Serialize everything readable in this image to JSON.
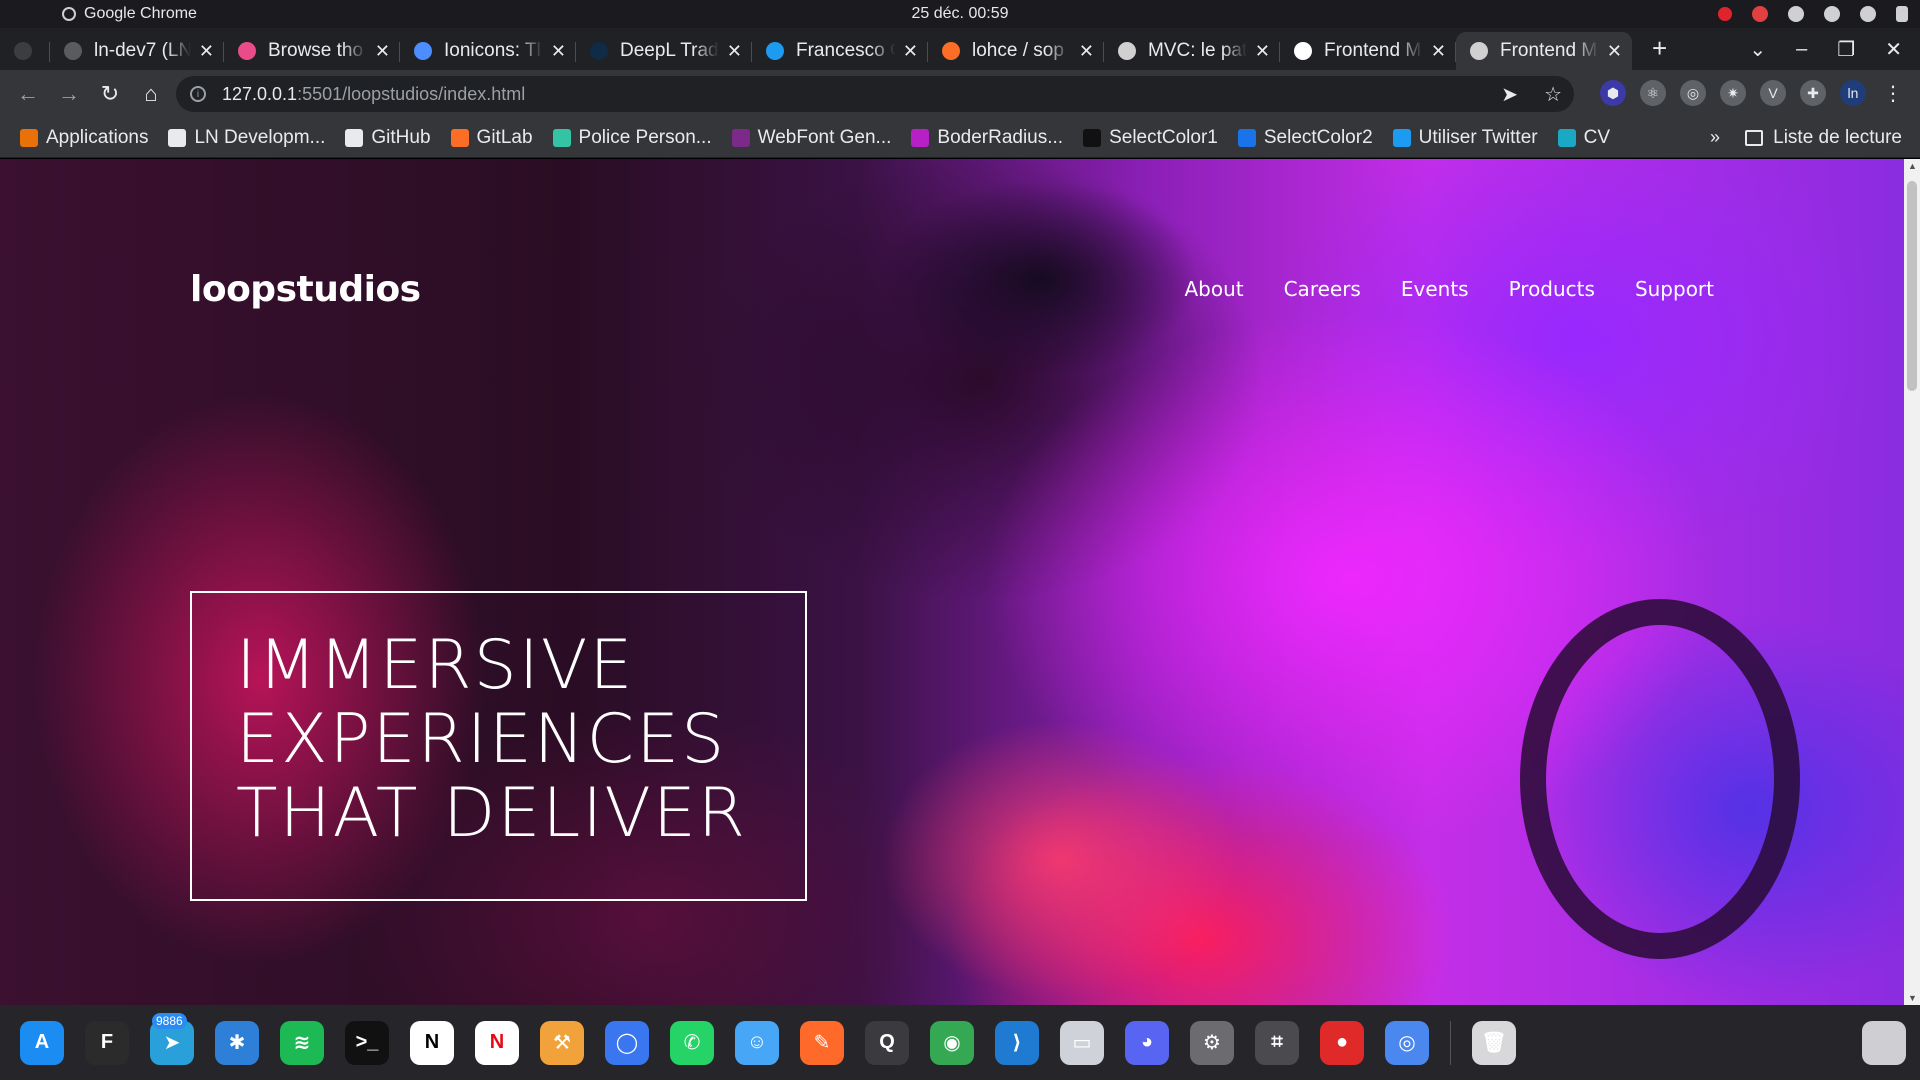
{
  "os_bar": {
    "app_name": "Google Chrome",
    "clock": "25 déc.  00:59"
  },
  "tabs": [
    {
      "title": "",
      "favicon": "github-icon",
      "color": "#3c3d41"
    },
    {
      "title": "ln-dev7 (LN",
      "favicon": "github-icon",
      "color": "#5a5b5f"
    },
    {
      "title": "Browse tho",
      "favicon": "dribbble-icon",
      "color": "#ea4c89"
    },
    {
      "title": "Ionicons: Tl",
      "favicon": "ionicons-icon",
      "color": "#4d8dff"
    },
    {
      "title": "DeepL Trad",
      "favicon": "deepl-icon",
      "color": "#0f2b46"
    },
    {
      "title": "Francesco C",
      "favicon": "twitter-icon",
      "color": "#1d9bf0"
    },
    {
      "title": "lohce / sop",
      "favicon": "gitlab-icon",
      "color": "#fc6d26"
    },
    {
      "title": "MVC: le pat",
      "favicon": "globe-icon",
      "color": "#d0d0d0"
    },
    {
      "title": "Frontend M",
      "favicon": "frontend-mentor-icon",
      "color": "#ffffff"
    },
    {
      "title": "Frontend M",
      "favicon": "frontend-mentor-icon",
      "color": "#d0d0d0",
      "active": true
    }
  ],
  "address_bar": {
    "host": "127.0.0.1",
    "path": ":5501/loopstudios/index.html"
  },
  "bookmarks": [
    {
      "label": "Applications",
      "icon": "apps-grid-icon",
      "color": "#e8710a"
    },
    {
      "label": "LN Developm...",
      "icon": "globe-icon",
      "color": "#e8eaed"
    },
    {
      "label": "GitHub",
      "icon": "github-icon",
      "color": "#e8eaed"
    },
    {
      "label": "GitLab",
      "icon": "gitlab-icon",
      "color": "#fc6d26"
    },
    {
      "label": "Police Person...",
      "icon": "feather-icon",
      "color": "#35c3a5"
    },
    {
      "label": "WebFont Gen...",
      "icon": "webfont-icon",
      "color": "#7b2a8a"
    },
    {
      "label": "BoderRadius...",
      "icon": "circle-icon",
      "color": "#b820c7"
    },
    {
      "label": "SelectColor1",
      "icon": "select-color-icon",
      "color": "#111111"
    },
    {
      "label": "SelectColor2",
      "icon": "select-color-icon",
      "color": "#1a73e8"
    },
    {
      "label": "Utiliser Twitter",
      "icon": "twitter-icon",
      "color": "#1d9bf0"
    },
    {
      "label": "CV",
      "icon": "n-logo-icon",
      "color": "#1aa8c4"
    }
  ],
  "bookmarks_more": "»",
  "reading_list": "Liste de lecture",
  "page": {
    "logo": "loopstudios",
    "nav": [
      "About",
      "Careers",
      "Events",
      "Products",
      "Support"
    ],
    "hero_lines": [
      "Immersive",
      "experiences",
      "that deliver"
    ]
  },
  "dock": [
    {
      "name": "app-store-icon",
      "color": "#1b8cf2",
      "glyph": "A"
    },
    {
      "name": "figma-icon",
      "color": "#2b2b2b",
      "glyph": "F"
    },
    {
      "name": "telegram-icon",
      "color": "#2aa0da",
      "glyph": "➤",
      "badge": "9886"
    },
    {
      "name": "utilities-icon",
      "color": "#2d7fd8",
      "glyph": "✱"
    },
    {
      "name": "spotify-icon",
      "color": "#1db954",
      "glyph": "≋"
    },
    {
      "name": "terminal-icon",
      "color": "#111111",
      "glyph": ">_"
    },
    {
      "name": "notion-icon",
      "color": "#ffffff",
      "glyph": "N",
      "text_color": "#000000"
    },
    {
      "name": "netflix-icon",
      "color": "#ffffff",
      "glyph": "N",
      "text_color": "#e50914"
    },
    {
      "name": "sublime-icon",
      "color": "#f2a23a",
      "glyph": "⚒"
    },
    {
      "name": "signal-icon",
      "color": "#3a76f0",
      "glyph": "◯"
    },
    {
      "name": "whatsapp-icon",
      "color": "#25d366",
      "glyph": "✆"
    },
    {
      "name": "finder-icon",
      "color": "#47a6f5",
      "glyph": "☺"
    },
    {
      "name": "pencil-app-icon",
      "color": "#ff6a2a",
      "glyph": "✎"
    },
    {
      "name": "quicktime-icon",
      "color": "#3b3b3f",
      "glyph": "Q"
    },
    {
      "name": "chrome-icon",
      "color": "#34a853",
      "glyph": "◉"
    },
    {
      "name": "vscode-icon",
      "color": "#1f7ad1",
      "glyph": "⟩"
    },
    {
      "name": "drive-icon",
      "color": "#cfd3d9",
      "glyph": "▭"
    },
    {
      "name": "discord-icon",
      "color": "#5865f2",
      "glyph": "◕"
    },
    {
      "name": "settings-icon",
      "color": "#6b6b70",
      "glyph": "⚙"
    },
    {
      "name": "screenshot-icon",
      "color": "#4a4a4f",
      "glyph": "⌗"
    },
    {
      "name": "record-icon",
      "color": "#e02a2a",
      "glyph": "●"
    },
    {
      "name": "chrome-canary-icon",
      "color": "#4a88f0",
      "glyph": "◎"
    },
    {
      "name": "trash-icon",
      "color": "#d8d8da",
      "glyph": "🗑"
    }
  ],
  "colors": {
    "page_accent_magenta": "#c42ee8",
    "hero_text": "#ffffff"
  }
}
